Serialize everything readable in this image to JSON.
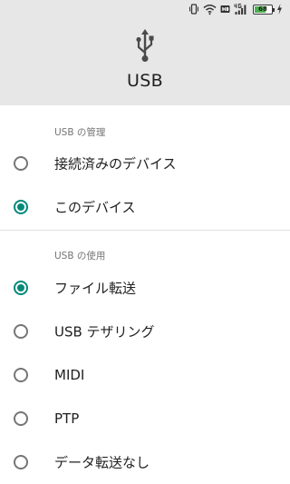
{
  "status_bar": {
    "battery_level": "68",
    "battery_fraction": 0.68,
    "icons": [
      "vibrate-icon",
      "wifi-icon",
      "hd-icon",
      "4g-signal-icon",
      "battery-icon",
      "charging-icon"
    ]
  },
  "header": {
    "icon": "usb-icon",
    "title": "USB"
  },
  "sections": [
    {
      "title": "USB の管理",
      "options": [
        {
          "label": "接続済みのデバイス",
          "checked": false
        },
        {
          "label": "このデバイス",
          "checked": true
        }
      ]
    },
    {
      "title": "USB の使用",
      "options": [
        {
          "label": "ファイル転送",
          "checked": true
        },
        {
          "label": "USB テザリング",
          "checked": false
        },
        {
          "label": "MIDI",
          "checked": false
        },
        {
          "label": "PTP",
          "checked": false
        },
        {
          "label": "データ転送なし",
          "checked": false
        }
      ]
    }
  ],
  "colors": {
    "accent": "#00897b",
    "header_bg": "#e7e7e7",
    "text_primary": "#212121",
    "text_secondary": "#757575",
    "radio_unchecked": "#757575",
    "battery_green": "#4caf50"
  }
}
